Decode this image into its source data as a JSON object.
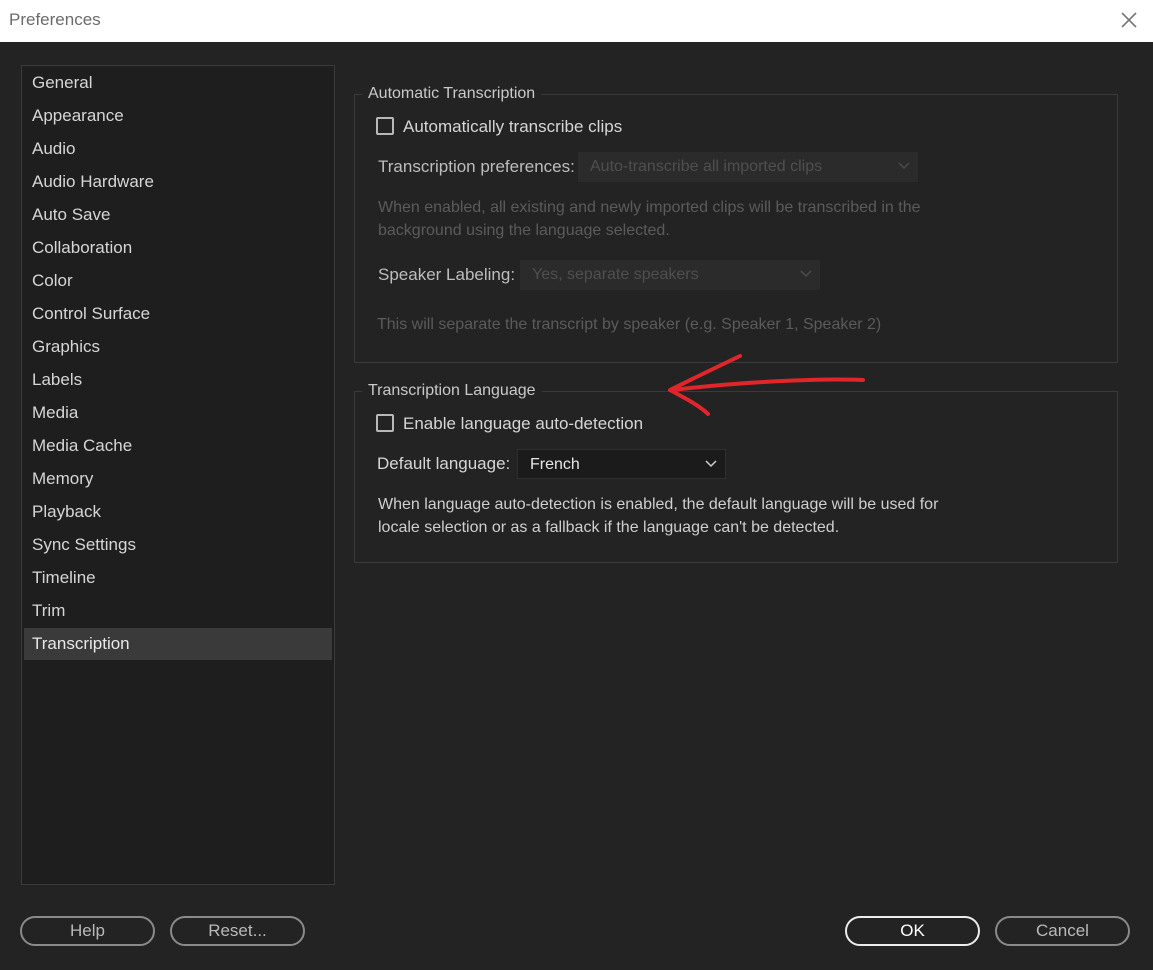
{
  "window": {
    "title": "Preferences"
  },
  "sidebar": {
    "items": [
      {
        "label": "General"
      },
      {
        "label": "Appearance"
      },
      {
        "label": "Audio"
      },
      {
        "label": "Audio Hardware"
      },
      {
        "label": "Auto Save"
      },
      {
        "label": "Collaboration"
      },
      {
        "label": "Color"
      },
      {
        "label": "Control Surface"
      },
      {
        "label": "Graphics"
      },
      {
        "label": "Labels"
      },
      {
        "label": "Media"
      },
      {
        "label": "Media Cache"
      },
      {
        "label": "Memory"
      },
      {
        "label": "Playback"
      },
      {
        "label": "Sync Settings"
      },
      {
        "label": "Timeline"
      },
      {
        "label": "Trim"
      },
      {
        "label": "Transcription"
      }
    ],
    "selected": "Transcription"
  },
  "auto_transcription": {
    "group_label": "Automatic Transcription",
    "checkbox_label": "Automatically transcribe clips",
    "checked": false,
    "prefs_label": "Transcription preferences:",
    "prefs_value": "Auto-transcribe all imported clips",
    "desc_line1": "When enabled, all existing and newly imported clips will be transcribed in the",
    "desc_line2": "background using the language selected.",
    "speaker_label": "Speaker Labeling:",
    "speaker_value": "Yes, separate speakers",
    "speaker_desc": "This will separate the transcript by speaker (e.g. Speaker 1, Speaker 2)"
  },
  "transcription_language": {
    "group_label": "Transcription Language",
    "checkbox_label": "Enable language auto-detection",
    "checked": false,
    "default_label": "Default language:",
    "default_value": "French",
    "desc_line1": "When language auto-detection is enabled, the default language will be used for",
    "desc_line2": "locale selection or as a fallback if the language can't be detected."
  },
  "buttons": {
    "help": "Help",
    "reset": "Reset...",
    "ok": "OK",
    "cancel": "Cancel"
  },
  "colors": {
    "background": "#232323",
    "annotation_arrow": "#e0262b"
  },
  "icons": {
    "close": "close-icon",
    "dropdown": "chevron-down-icon",
    "annotation": "arrow-annotation"
  }
}
